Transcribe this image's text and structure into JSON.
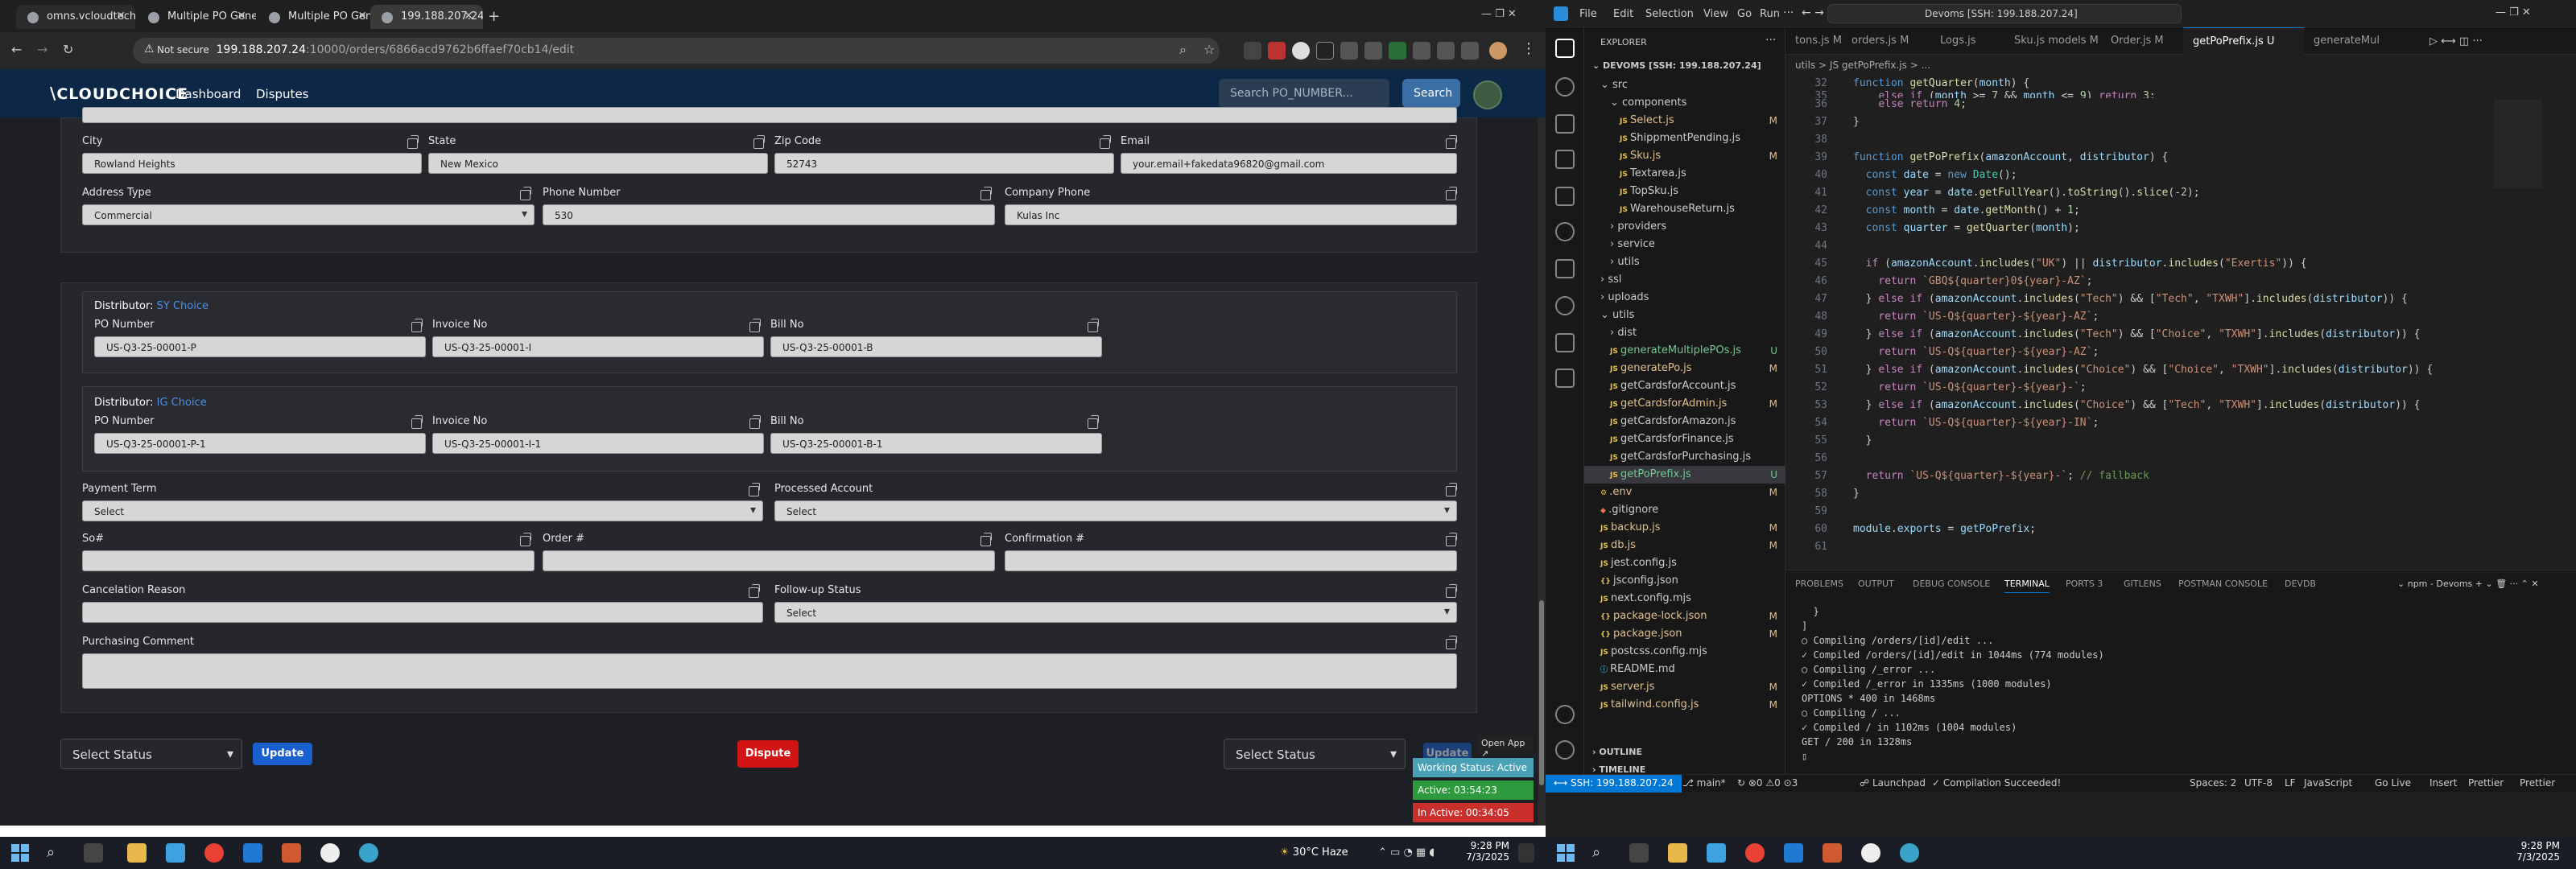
{
  "browser": {
    "tabs": [
      {
        "title": "omns.vcloudtech.org/dashboard"
      },
      {
        "title": "Multiple PO Generation"
      },
      {
        "title": "Multiple PO Generation"
      },
      {
        "title": "199.188.207.24:10000/orders/6"
      }
    ],
    "not_secure": "Not secure",
    "url_host": "199.188.207.24",
    "url_path": ":10000/orders/6866acd9762b6ffaef70cb14/edit"
  },
  "app": {
    "logo": "CLOUDCHOICE",
    "nav": [
      "Dashboard",
      "Disputes"
    ],
    "search_placeholder": "Search PO_NUMBER...",
    "search_button": "Search"
  },
  "form": {
    "address": {
      "city_label": "City",
      "city": "Rowland Heights",
      "state_label": "State",
      "state": "New Mexico",
      "zip_label": "Zip Code",
      "zip": "52743",
      "email_label": "Email",
      "email": "your.email+fakedata96820@gmail.com",
      "type_label": "Address Type",
      "type": "Commercial",
      "phone_label": "Phone Number",
      "phone": "530",
      "company_label": "Company Phone",
      "company": "Kulas Inc"
    },
    "distributors": [
      {
        "label": "Distributor:",
        "name": "SY Choice",
        "po_label": "PO Number",
        "po": "US-Q3-25-00001-P",
        "inv_label": "Invoice No",
        "inv": "US-Q3-25-00001-I",
        "bill_label": "Bill No",
        "bill": "US-Q3-25-00001-B"
      },
      {
        "label": "Distributor:",
        "name": "IG Choice",
        "po_label": "PO Number",
        "po": "US-Q3-25-00001-P-1",
        "inv_label": "Invoice No",
        "inv": "US-Q3-25-00001-I-1",
        "bill_label": "Bill No",
        "bill": "US-Q3-25-00001-B-1"
      }
    ],
    "payment_term_label": "Payment Term",
    "payment_term": "Select",
    "processed_label": "Processed Account",
    "processed": "Select",
    "so_label": "So#",
    "order_label": "Order #",
    "confirmation_label": "Confirmation #",
    "cancel_label": "Cancelation Reason",
    "followup_label": "Follow-up Status",
    "followup": "Select",
    "comment_label": "Purchasing Comment"
  },
  "footer": {
    "select_status": "Select Status",
    "update": "Update",
    "dispute": "Dispute",
    "select_status2": "Select Status",
    "update_hidden": "Update",
    "open_app": "Open App",
    "working_status": "Working Status: Active",
    "active": "Active: 03:54:23",
    "inactive": "In Active: 00:34:05"
  },
  "win_taskbar_left": {
    "weather": "30°C  Haze",
    "time": "9:28 PM",
    "date": "7/3/2025"
  },
  "win_taskbar_right": {
    "time": "9:28 PM",
    "date": "7/3/2025"
  },
  "vscode": {
    "menu": [
      "File",
      "Edit",
      "Selection",
      "View",
      "Go",
      "Run"
    ],
    "command_center": "Devoms [SSH: 199.188.207.24]",
    "explorer_title": "EXPLORER",
    "root": "DEVOMS [SSH: 199.188.207.24]",
    "tree": [
      {
        "name": "src",
        "indent": 1,
        "type": "folder",
        "open": true
      },
      {
        "name": "components",
        "indent": 2,
        "type": "folder",
        "open": true
      },
      {
        "name": "Select.js",
        "indent": 3,
        "type": "js",
        "status": "M"
      },
      {
        "name": "ShippmentPending.js",
        "indent": 3,
        "type": "js",
        "status": ""
      },
      {
        "name": "Sku.js",
        "indent": 3,
        "type": "js",
        "status": "M"
      },
      {
        "name": "Textarea.js",
        "indent": 3,
        "type": "js",
        "status": ""
      },
      {
        "name": "TopSku.js",
        "indent": 3,
        "type": "js",
        "status": ""
      },
      {
        "name": "WarehouseReturn.js",
        "indent": 3,
        "type": "js",
        "status": ""
      },
      {
        "name": "providers",
        "indent": 2,
        "type": "folder",
        "open": false
      },
      {
        "name": "service",
        "indent": 2,
        "type": "folder",
        "open": false
      },
      {
        "name": "utils",
        "indent": 2,
        "type": "folder",
        "open": false
      },
      {
        "name": "ssl",
        "indent": 1,
        "type": "folder",
        "open": false
      },
      {
        "name": "uploads",
        "indent": 1,
        "type": "folder",
        "open": false
      },
      {
        "name": "utils",
        "indent": 1,
        "type": "folder",
        "open": true
      },
      {
        "name": "dist",
        "indent": 2,
        "type": "folder",
        "open": false
      },
      {
        "name": "generateMultiplePOs.js",
        "indent": 2,
        "type": "js",
        "status": "U"
      },
      {
        "name": "generatePo.js",
        "indent": 2,
        "type": "js",
        "status": "M"
      },
      {
        "name": "getCardsforAccount.js",
        "indent": 2,
        "type": "js",
        "status": ""
      },
      {
        "name": "getCardsforAdmin.js",
        "indent": 2,
        "type": "js",
        "status": "M"
      },
      {
        "name": "getCardsforAmazon.js",
        "indent": 2,
        "type": "js",
        "status": ""
      },
      {
        "name": "getCardsforFinance.js",
        "indent": 2,
        "type": "js",
        "status": ""
      },
      {
        "name": "getCardsforPurchasing.js",
        "indent": 2,
        "type": "js",
        "status": ""
      },
      {
        "name": "getPoPrefix.js",
        "indent": 2,
        "type": "js",
        "status": "U",
        "active": true
      },
      {
        "name": ".env",
        "indent": 1,
        "type": "env",
        "status": "M"
      },
      {
        "name": ".gitignore",
        "indent": 1,
        "type": "git",
        "status": ""
      },
      {
        "name": "backup.js",
        "indent": 1,
        "type": "js",
        "status": "M"
      },
      {
        "name": "db.js",
        "indent": 1,
        "type": "js",
        "status": "M"
      },
      {
        "name": "jest.config.js",
        "indent": 1,
        "type": "js",
        "status": ""
      },
      {
        "name": "jsconfig.json",
        "indent": 1,
        "type": "json",
        "status": ""
      },
      {
        "name": "next.config.mjs",
        "indent": 1,
        "type": "js",
        "status": ""
      },
      {
        "name": "package-lock.json",
        "indent": 1,
        "type": "json",
        "status": "M"
      },
      {
        "name": "package.json",
        "indent": 1,
        "type": "json",
        "status": "M"
      },
      {
        "name": "postcss.config.mjs",
        "indent": 1,
        "type": "js",
        "status": ""
      },
      {
        "name": "README.md",
        "indent": 1,
        "type": "md",
        "status": ""
      },
      {
        "name": "server.js",
        "indent": 1,
        "type": "js",
        "status": "M"
      },
      {
        "name": "tailwind.config.js",
        "indent": 1,
        "type": "js",
        "status": "M"
      }
    ],
    "outline": "OUTLINE",
    "timeline": "TIMELINE",
    "tabs": [
      "tons.js M",
      "orders.js M",
      "Logs.js",
      "Sku.js models M",
      "Order.js M",
      "getPoPrefix.js U",
      "generateMul"
    ],
    "breadcrumb": "utils > JS getPoPrefix.js > ...",
    "panel_tabs": [
      "PROBLEMS",
      "OUTPUT",
      "DEBUG CONSOLE",
      "TERMINAL",
      "PORTS 3",
      "GITLENS",
      "POSTMAN CONSOLE",
      "DEVDB"
    ],
    "terminal_label": "npm - Devoms",
    "terminal": [
      "  }",
      "]",
      "○ Compiling /orders/[id]/edit ...",
      "✓ Compiled /orders/[id]/edit in 1044ms (774 modules)",
      "○ Compiling /_error ...",
      "✓ Compiled /_error in 1335ms (1000 modules)",
      "OPTIONS * 400 in 1468ms",
      "○ Compiling / ...",
      "✓ Compiled / in 1102ms (1004 modules)",
      "GET / 200 in 1328ms"
    ],
    "status_bar": {
      "remote": "SSH: 199.188.207.24",
      "branch": "main*",
      "launchpad": "Launchpad",
      "compile": "Compilation Succeeded!",
      "spaces": "Spaces: 2",
      "enc": "UTF-8",
      "eol": "LF",
      "lang": "JavaScript",
      "golive": "Go Live",
      "insert": "Insert",
      "prettier": "Prettier"
    }
  }
}
